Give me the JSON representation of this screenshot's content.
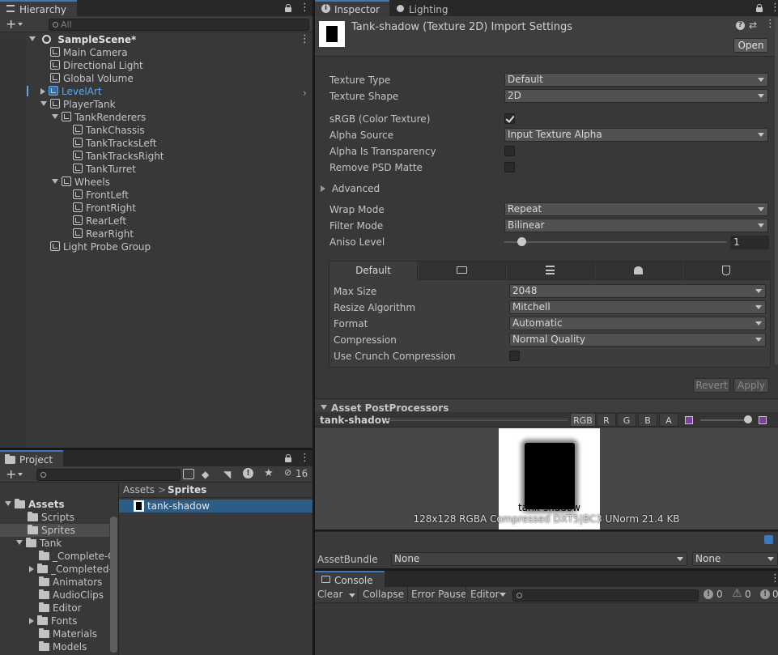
{
  "hierarchy": {
    "tab_label": "Hierarchy",
    "add_label": "+",
    "search_placeholder": "All",
    "scene_name": "SampleScene*",
    "items": [
      {
        "label": "Main Camera"
      },
      {
        "label": "Directional Light"
      },
      {
        "label": "Global Volume"
      },
      {
        "label": "LevelArt"
      },
      {
        "label": "PlayerTank"
      },
      {
        "label": "TankRenderers"
      },
      {
        "label": "TankChassis"
      },
      {
        "label": "TankTracksLeft"
      },
      {
        "label": "TankTracksRight"
      },
      {
        "label": "TankTurret"
      },
      {
        "label": "Wheels"
      },
      {
        "label": "FrontLeft"
      },
      {
        "label": "FrontRight"
      },
      {
        "label": "RearLeft"
      },
      {
        "label": "RearRight"
      },
      {
        "label": "Light Probe Group"
      }
    ]
  },
  "project": {
    "tab_label": "Project",
    "hidden_count": "16",
    "tree": [
      {
        "label": "Assets"
      },
      {
        "label": "Scripts"
      },
      {
        "label": "Sprites"
      },
      {
        "label": "Tank"
      },
      {
        "label": "_Complete-C"
      },
      {
        "label": "_Completed-"
      },
      {
        "label": "Animators"
      },
      {
        "label": "AudioClips"
      },
      {
        "label": "Editor"
      },
      {
        "label": "Fonts"
      },
      {
        "label": "Materials"
      },
      {
        "label": "Models"
      }
    ],
    "breadcrumb_root": "Assets",
    "breadcrumb_sep": ">",
    "breadcrumb_current": "Sprites",
    "file": "tank-shadow"
  },
  "inspector": {
    "tab_label": "Inspector",
    "lighting_tab_label": "Lighting",
    "title": "Tank-shadow (Texture 2D) Import Settings",
    "open_label": "Open",
    "fields": {
      "texture_type_label": "Texture Type",
      "texture_type_value": "Default",
      "texture_shape_label": "Texture Shape",
      "texture_shape_value": "2D",
      "srgb_label": "sRGB (Color Texture)",
      "alpha_source_label": "Alpha Source",
      "alpha_source_value": "Input Texture Alpha",
      "alpha_transparency_label": "Alpha Is Transparency",
      "remove_psd_label": "Remove PSD Matte",
      "advanced_label": "Advanced",
      "wrap_mode_label": "Wrap Mode",
      "wrap_mode_value": "Repeat",
      "filter_mode_label": "Filter Mode",
      "filter_mode_value": "Bilinear",
      "aniso_label": "Aniso Level",
      "aniso_value": "1"
    },
    "platform": {
      "default_tab": "Default",
      "max_size_label": "Max Size",
      "max_size_value": "2048",
      "resize_label": "Resize Algorithm",
      "resize_value": "Mitchell",
      "format_label": "Format",
      "format_value": "Automatic",
      "compression_label": "Compression",
      "compression_value": "Normal Quality",
      "crunch_label": "Use Crunch Compression"
    },
    "revert_label": "Revert",
    "apply_label": "Apply",
    "postprocessors_label": "Asset PostProcessors"
  },
  "preview": {
    "name": "tank-shadow",
    "channels": [
      "RGB",
      "R",
      "G",
      "B",
      "A"
    ],
    "image_label": "tank-shadow",
    "info": "128x128  RGBA Compressed DXT5|BC3 UNorm  21.4 KB"
  },
  "assetbundle": {
    "label": "AssetBundle",
    "name_value": "None",
    "variant_value": "None"
  },
  "console": {
    "tab_label": "Console",
    "clear_label": "Clear",
    "collapse_label": "Collapse",
    "error_pause_label": "Error Pause",
    "editor_label": "Editor",
    "errors_count": "0",
    "warnings_count": "0",
    "logs_count": "0"
  },
  "colors": {
    "accent": "#3a79bb",
    "selection": "#2c5d87",
    "link_blue": "#5aa7ef"
  }
}
